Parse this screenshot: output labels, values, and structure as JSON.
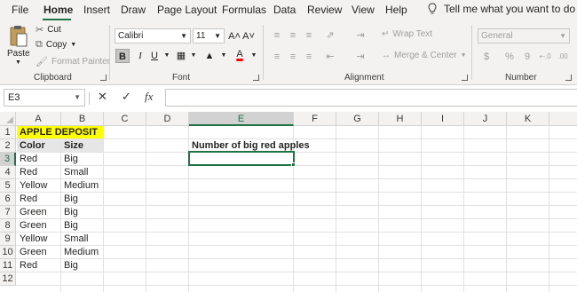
{
  "menu": {
    "tabs": [
      "File",
      "Home",
      "Insert",
      "Draw",
      "Page Layout",
      "Formulas",
      "Data",
      "Review",
      "View",
      "Help"
    ],
    "active_tab": "Home",
    "tell_me": "Tell me what you want to do"
  },
  "ribbon": {
    "clipboard": {
      "paste_label": "Paste",
      "cut_label": "Cut",
      "copy_label": "Copy",
      "format_painter_label": "Format Painter",
      "group_label": "Clipboard"
    },
    "font": {
      "font_name": "Calibri",
      "font_size": "11",
      "bold": "B",
      "italic": "I",
      "underline": "U",
      "grow_font": "A˄",
      "shrink_font": "A˅",
      "font_color_glyph": "A",
      "group_label": "Font",
      "font_color_hex": "#ff0000"
    },
    "alignment": {
      "wrap_text_label": "Wrap Text",
      "merge_center_label": "Merge & Center",
      "group_label": "Alignment"
    },
    "number": {
      "format": "General",
      "currency_symbol": "$",
      "percent_symbol": "%",
      "comma_symbol": "9",
      "increase_decimal": "⇠.0",
      "decrease_decimal": ".00",
      "group_label": "Number"
    }
  },
  "formula_bar": {
    "name_box": "E3",
    "cancel_glyph": "✕",
    "enter_glyph": "✓",
    "fx_glyph": "fx",
    "value": ""
  },
  "sheet": {
    "columns": [
      "A",
      "B",
      "C",
      "D",
      "E",
      "F",
      "G",
      "H",
      "I",
      "J",
      "K"
    ],
    "rows": [
      "1",
      "2",
      "3",
      "4",
      "5",
      "6",
      "7",
      "8",
      "9",
      "10",
      "11",
      "12"
    ],
    "selected_cell": "E3",
    "title": "APPLE DEPOSIT",
    "header_color": "Color",
    "header_size": "Size",
    "records": [
      {
        "color": "Red",
        "size": "Big"
      },
      {
        "color": "Red",
        "size": "Small"
      },
      {
        "color": "Yellow",
        "size": "Medium"
      },
      {
        "color": "Red",
        "size": "Big"
      },
      {
        "color": "Green",
        "size": "Big"
      },
      {
        "color": "Green",
        "size": "Big"
      },
      {
        "color": "Yellow",
        "size": "Small"
      },
      {
        "color": "Green",
        "size": "Medium"
      },
      {
        "color": "Red",
        "size": "Big"
      }
    ],
    "e2_label": "Number of big red apples",
    "title_fill": "#ffff00",
    "header_fill": "#e7e6e6",
    "accent": "#217346"
  }
}
